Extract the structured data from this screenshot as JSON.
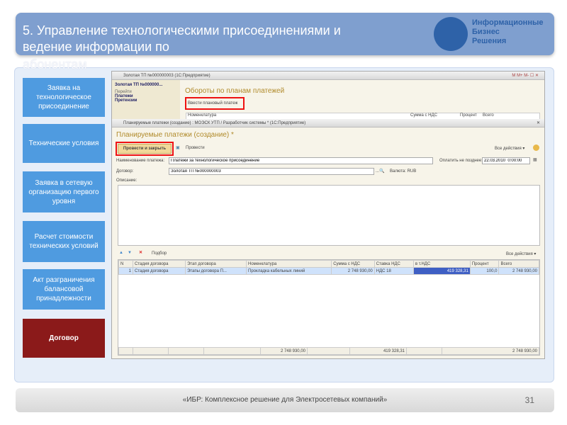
{
  "header": {
    "title": "5. Управление технологическими присоединениями  и ведение информации по",
    "title_overflow": "абонентам",
    "logo": {
      "line1": "Информационные",
      "line2": "Бизнес",
      "line3": "Решения"
    }
  },
  "sidebar": {
    "items": [
      {
        "label": "Заявка на технологическое присоединение"
      },
      {
        "label": "Технические условия"
      },
      {
        "label": "Заявка в сетевую организацию первого уровня"
      },
      {
        "label": "Расчет стоимости технических условий"
      },
      {
        "label": "Акт разграничения балансовой принадлежности"
      },
      {
        "label": "Договор"
      }
    ]
  },
  "win1": {
    "title": "Золотая ТП №000000003 (1С:Предприятие)",
    "nav_title": "Золотая ТП №000000...",
    "nav": [
      "Перейти",
      "Платежи",
      "Претензии"
    ],
    "heading": "Обороты по планам платежей",
    "action": "Ввести плановый платеж",
    "cols": [
      "Номенклатура",
      "Сумма с НДС",
      "Процент",
      "Всего"
    ],
    "tb": [
      "M",
      "M+",
      "M-"
    ]
  },
  "win2": {
    "title": "Планируемые платежи (создание) : МОЭСК УТП / Разработчик системы * (1С:Предприятие)",
    "heading": "Планируемые платежи (создание) *",
    "btn_post_close": "Провести и закрыть",
    "btn_post": "Провести",
    "all_actions": "Все действия ▾",
    "name_label": "Наименование платежа:",
    "name_value": "Платежи за технологическое присоединение",
    "pay_label": "Оплатить не позднее:",
    "pay_value": "22.03.2010  0:00:00",
    "contract_label": "Договор:",
    "contract_value": "Золотая ТП №000000003",
    "currency_label": "Валюта:",
    "currency_value": "RUB",
    "desc_label": "Описание:",
    "pick": "Подбор",
    "all_actions2": "Все действия ▾",
    "cols": [
      "N",
      "Стадия договора",
      "Этап договора",
      "Номенклатура",
      "Сумма с НДС",
      "Ставка НДС",
      "в т.НДС",
      "Процент",
      "Всего"
    ],
    "row": [
      "1",
      "Стадия договора",
      "Этапы договора П...",
      "Прокладка кабельных линий",
      "2 748 930,00",
      "НДС 18",
      "419 328,31",
      "100,0",
      "2 748 930,00"
    ],
    "totals": {
      "sum": "2 748 930,00",
      "vat": "419 328,31",
      "total": "2 748 930,00"
    }
  },
  "footer": {
    "text": "«ИБР: Комплексное решение для Электросетевых компаний»",
    "page": "31"
  }
}
